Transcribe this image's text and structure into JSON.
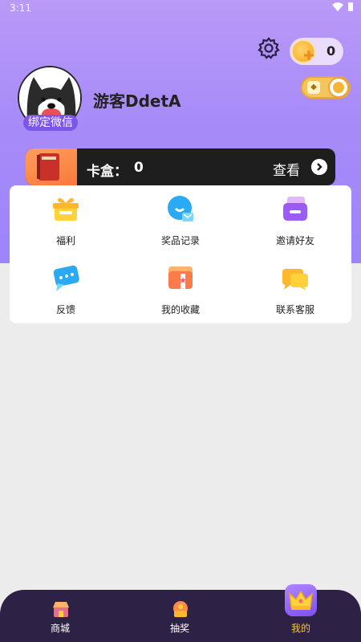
{
  "status_bar": {
    "time": "3:11"
  },
  "header": {
    "coins": "0",
    "username": "游客DdetA",
    "bind_wechat": "绑定微信",
    "colors": {
      "gradient_top": "#b99af7",
      "gradient_bottom": "#9d84fa"
    }
  },
  "card_box": {
    "label": "卡盒：",
    "count": "0",
    "view": "查看"
  },
  "menu": {
    "items": [
      {
        "label": "福利",
        "icon": "gift-icon"
      },
      {
        "label": "奖品记录",
        "icon": "record-icon"
      },
      {
        "label": "邀请好友",
        "icon": "invite-icon"
      },
      {
        "label": "反馈",
        "icon": "feedback-icon"
      },
      {
        "label": "我的收藏",
        "icon": "favorites-icon"
      },
      {
        "label": "联系客服",
        "icon": "customer-service-icon"
      }
    ]
  },
  "bottom_nav": {
    "items": [
      {
        "label": "商城",
        "icon": "shop-icon"
      },
      {
        "label": "抽奖",
        "icon": "lottery-icon"
      },
      {
        "label": "我的",
        "icon": "crown-icon",
        "active": true
      }
    ],
    "active_color": "#f5c24a"
  }
}
